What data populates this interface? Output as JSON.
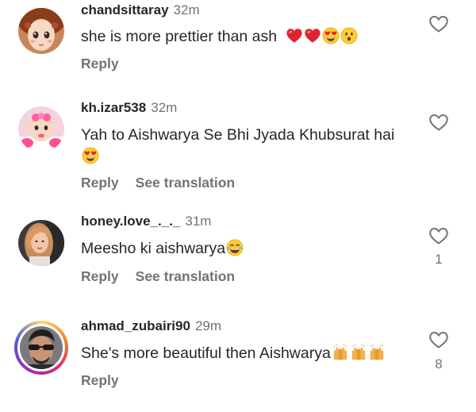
{
  "comments": [
    {
      "username": "chandsittaray",
      "time": "32m",
      "text": "she is more prettier than ash",
      "emojis": [
        "red-heart",
        "red-heart",
        "heart-eyes-face",
        "surprised-face"
      ],
      "reply_label": "Reply",
      "translation_label": null,
      "likes": null
    },
    {
      "username": "kh.izar538",
      "time": "32m",
      "text": "Yah to Aishwarya Se Bhi Jyada Khubsurat hai",
      "emojis": [
        "heart-eyes-face"
      ],
      "reply_label": "Reply",
      "translation_label": "See translation",
      "likes": null
    },
    {
      "username": "honey.love_._._",
      "time": "31m",
      "text": "Meesho ki aishwarya",
      "emojis": [
        "tears-of-joy-face"
      ],
      "reply_label": "Reply",
      "translation_label": "See translation",
      "likes": "1"
    },
    {
      "username": "ahmad_zubairi90",
      "time": "29m",
      "text": "She's more beautiful then Aishwarya",
      "emojis": [
        "raising-hands",
        "raising-hands",
        "raising-hands"
      ],
      "reply_label": "Reply",
      "translation_label": null,
      "likes": "8"
    }
  ],
  "icons": {
    "like": "heart-outline-icon"
  },
  "colors": {
    "text": "#262626",
    "secondary": "#737373",
    "background": "#ffffff"
  }
}
